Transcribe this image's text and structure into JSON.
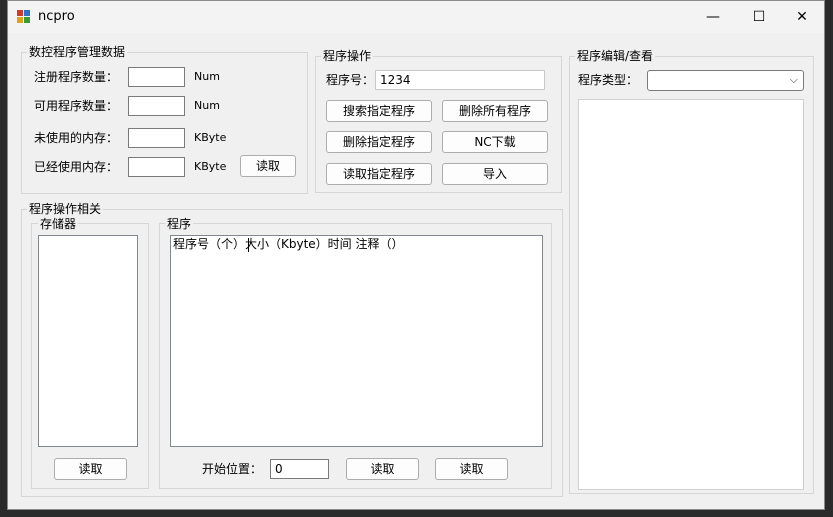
{
  "window": {
    "title": "ncpro",
    "minimize_symbol": "—",
    "maximize_symbol": "☐",
    "close_symbol": "✕"
  },
  "nc_data": {
    "title": "数控程序管理数据",
    "registered_label": "注册程序数量：",
    "registered_value": "",
    "registered_unit": "Num",
    "available_label": "可用程序数量：",
    "available_value": "",
    "available_unit": "Num",
    "unused_label": "未使用的内存：",
    "unused_value": "",
    "unused_unit": "KByte",
    "used_label": "已经使用内存：",
    "used_value": "",
    "used_unit": "KByte",
    "read_button": "读取"
  },
  "program_ops": {
    "title": "程序操作",
    "program_no_label": "程序号：",
    "program_no_value": "1234",
    "search_button": "搜索指定程序",
    "delete_all_button": "删除所有程序",
    "delete_button": "删除指定程序",
    "nc_download_button": "NC下载",
    "read_program_button": "读取指定程序",
    "import_button": "导入"
  },
  "related": {
    "title": "程序操作相关",
    "storage_title": "存储器",
    "storage_read_button": "读取",
    "program_title": "程序",
    "list_header": "程序号（个）大小（Kbyte）时间      注释（）",
    "start_pos_label": "开始位置：",
    "start_pos_value": "0",
    "read_button_1": "读取",
    "read_button_2": "读取"
  },
  "editor": {
    "title": "程序编辑/查看",
    "type_label": "程序类型：",
    "type_value": "",
    "dropdown_symbol": "⌵"
  },
  "colors": {
    "icon_red": "#d03a2a",
    "icon_blue": "#2f6fd0",
    "icon_yellow": "#e0a21c",
    "icon_green": "#3a9a3a"
  }
}
